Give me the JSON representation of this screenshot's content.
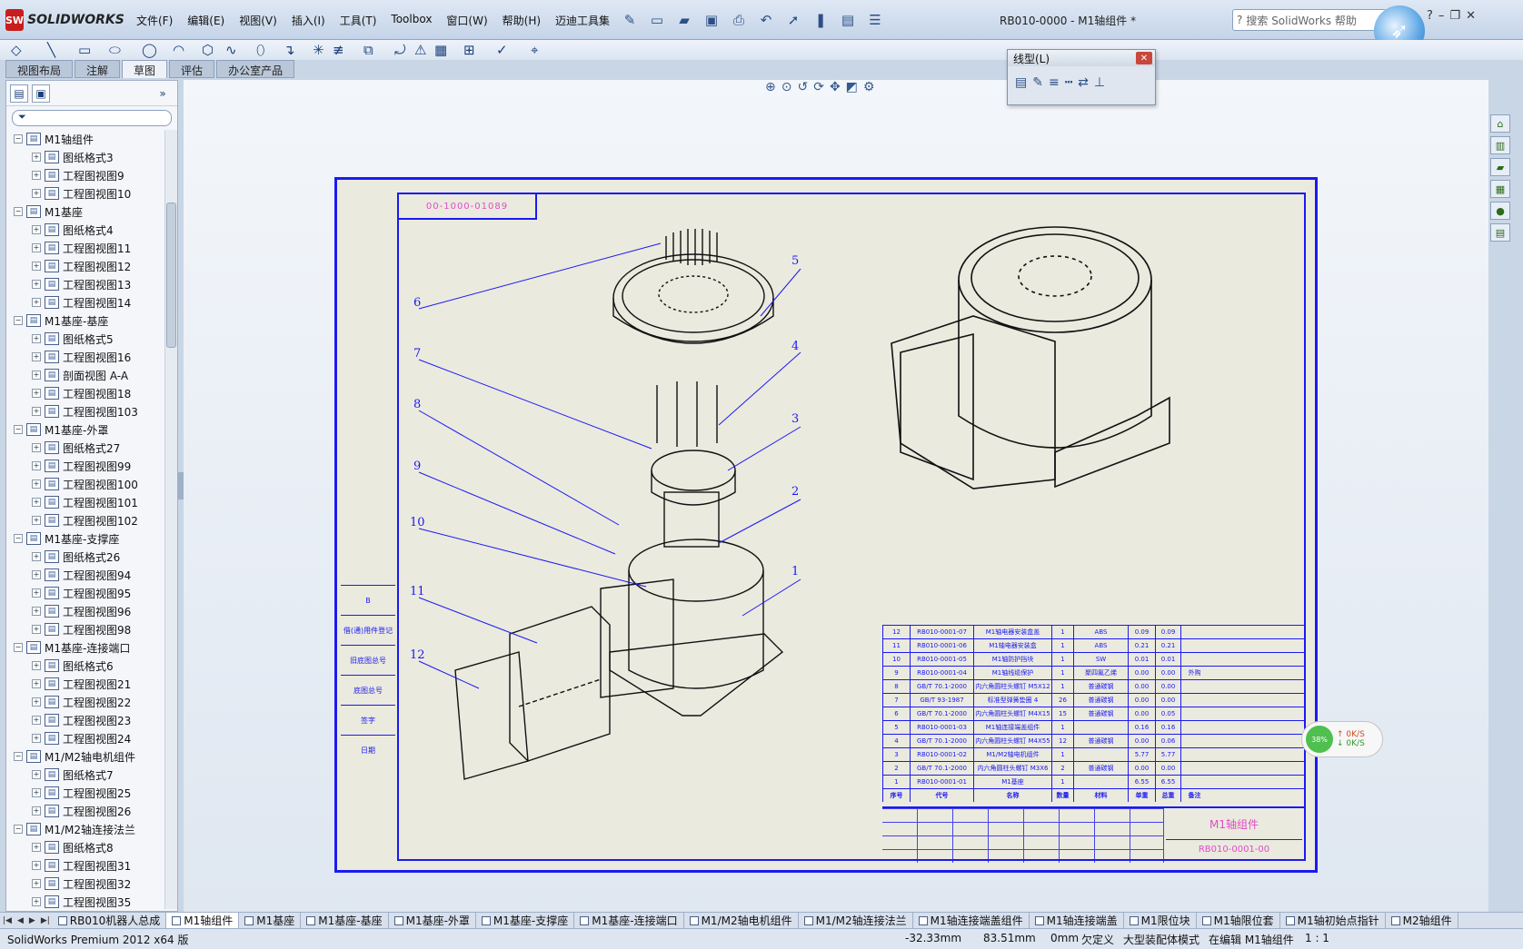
{
  "app": {
    "logo_text": "SOLIDWORKS",
    "doc_title": "RB010-0000 - M1轴组件 *",
    "menu": [
      "文件(F)",
      "编辑(E)",
      "视图(V)",
      "插入(I)",
      "工具(T)",
      "Toolbox",
      "窗口(W)",
      "帮助(H)",
      "迈迪工具集"
    ],
    "help_placeholder": "搜索 SolidWorks 帮助"
  },
  "tabs": [
    "视图布局",
    "注解",
    "草图",
    "评估",
    "办公室产品"
  ],
  "active_tab": "草图",
  "feature_tree": [
    {
      "label": "M1轴组件",
      "level": 0
    },
    {
      "label": "图纸格式3",
      "level": 1
    },
    {
      "label": "工程图视图9",
      "level": 1
    },
    {
      "label": "工程图视图10",
      "level": 1
    },
    {
      "label": "M1基座",
      "level": 0
    },
    {
      "label": "图纸格式4",
      "level": 1
    },
    {
      "label": "工程图视图11",
      "level": 1
    },
    {
      "label": "工程图视图12",
      "level": 1
    },
    {
      "label": "工程图视图13",
      "level": 1
    },
    {
      "label": "工程图视图14",
      "level": 1
    },
    {
      "label": "M1基座-基座",
      "level": 0
    },
    {
      "label": "图纸格式5",
      "level": 1
    },
    {
      "label": "工程图视图16",
      "level": 1
    },
    {
      "label": "剖面视图 A-A",
      "level": 1
    },
    {
      "label": "工程图视图18",
      "level": 1
    },
    {
      "label": "工程图视图103",
      "level": 1
    },
    {
      "label": "M1基座-外罩",
      "level": 0
    },
    {
      "label": "图纸格式27",
      "level": 1
    },
    {
      "label": "工程图视图99",
      "level": 1
    },
    {
      "label": "工程图视图100",
      "level": 1
    },
    {
      "label": "工程图视图101",
      "level": 1
    },
    {
      "label": "工程图视图102",
      "level": 1
    },
    {
      "label": "M1基座-支撑座",
      "level": 0
    },
    {
      "label": "图纸格式26",
      "level": 1
    },
    {
      "label": "工程图视图94",
      "level": 1
    },
    {
      "label": "工程图视图95",
      "level": 1
    },
    {
      "label": "工程图视图96",
      "level": 1
    },
    {
      "label": "工程图视图98",
      "level": 1
    },
    {
      "label": "M1基座-连接端口",
      "level": 0
    },
    {
      "label": "图纸格式6",
      "level": 1
    },
    {
      "label": "工程图视图21",
      "level": 1
    },
    {
      "label": "工程图视图22",
      "level": 1
    },
    {
      "label": "工程图视图23",
      "level": 1
    },
    {
      "label": "工程图视图24",
      "level": 1
    },
    {
      "label": "M1/M2轴电机组件",
      "level": 0
    },
    {
      "label": "图纸格式7",
      "level": 1
    },
    {
      "label": "工程图视图25",
      "level": 1
    },
    {
      "label": "工程图视图26",
      "level": 1
    },
    {
      "label": "M1/M2轴连接法兰",
      "level": 0
    },
    {
      "label": "图纸格式8",
      "level": 1
    },
    {
      "label": "工程图视图31",
      "level": 1
    },
    {
      "label": "工程图视图32",
      "level": 1
    },
    {
      "label": "工程图视图35",
      "level": 1
    }
  ],
  "linetype_toolbar": {
    "title": "线型(L)"
  },
  "drawing": {
    "top_code": "00-1000-01089",
    "balloons": [
      "6",
      "5",
      "7",
      "4",
      "8",
      "3",
      "9",
      "2",
      "10",
      "1",
      "11",
      "12"
    ],
    "part_name": "M1轴组件",
    "part_code": "RB010-0001-00",
    "side_labels": [
      "B",
      "借(通)用件登记",
      "旧底图总号",
      "底图总号",
      "签字",
      "日期"
    ],
    "bom": [
      [
        "12",
        "RB010-0001-07",
        "M1轴电器安装盒盖",
        "1",
        "ABS",
        "0.09",
        "0.09",
        ""
      ],
      [
        "11",
        "RB010-0001-06",
        "M1轴电器安装盒",
        "1",
        "ABS",
        "0.21",
        "0.21",
        ""
      ],
      [
        "10",
        "RB010-0001-05",
        "M1轴防护挡块",
        "1",
        "SW",
        "0.01",
        "0.01",
        ""
      ],
      [
        "9",
        "RB010-0001-04",
        "M1轴线缆保护",
        "1",
        "聚四氟乙烯",
        "0.00",
        "0.00",
        "外购"
      ],
      [
        "8",
        "GB/T 70.1-2000",
        "内六角圆柱头螺钉 M5X12",
        "1",
        "普通碳钢",
        "0.00",
        "0.00",
        ""
      ],
      [
        "7",
        "GB/T 93-1987",
        "标准型弹簧垫圈 4",
        "26",
        "普通碳钢",
        "0.00",
        "0.00",
        ""
      ],
      [
        "6",
        "GB/T 70.1-2000",
        "内六角圆柱头螺钉 M4X15",
        "15",
        "普通碳钢",
        "0.00",
        "0.05",
        ""
      ],
      [
        "5",
        "RB010-0001-03",
        "M1轴连接端盖组件",
        "1",
        "",
        "0.16",
        "0.16",
        ""
      ],
      [
        "4",
        "GB/T 70.1-2000",
        "内六角圆柱头螺钉 M4X55",
        "12",
        "普通碳钢",
        "0.00",
        "0.06",
        ""
      ],
      [
        "3",
        "RB010-0001-02",
        "M1/M2轴电机组件",
        "1",
        "",
        "5.77",
        "5.77",
        ""
      ],
      [
        "2",
        "GB/T 70.1-2000",
        "内六角圆柱头螺钉 M3X6",
        "2",
        "普通碳钢",
        "0.00",
        "0.00",
        ""
      ],
      [
        "1",
        "RB010-0001-01",
        "M1基座",
        "1",
        "",
        "6.55",
        "6.55",
        ""
      ]
    ],
    "bom_header": [
      "序号",
      "代号",
      "名称",
      "数量",
      "材料",
      "单重",
      "总重",
      "备注"
    ]
  },
  "speed_widget": {
    "percent": "38%",
    "up": "0K/S",
    "down": "0K/S"
  },
  "sheet_tabs": [
    "RB010机器人总成",
    "M1轴组件",
    "M1基座",
    "M1基座-基座",
    "M1基座-外罩",
    "M1基座-支撑座",
    "M1基座-连接端口",
    "M1/M2轴电机组件",
    "M1/M2轴连接法兰",
    "M1轴连接端盖组件",
    "M1轴连接端盖",
    "M1限位块",
    "M1轴限位套",
    "M1轴初始点指针",
    "M2轴组件"
  ],
  "active_sheet": "M1轴组件",
  "status": {
    "product": "SolidWorks Premium 2012 x64 版",
    "x": "-32.33mm",
    "y": "83.51mm",
    "z": "0mm",
    "defined": "欠定义",
    "mode": "大型装配体模式",
    "editing": "在编辑 M1轴组件",
    "scale": "1 : 1"
  }
}
